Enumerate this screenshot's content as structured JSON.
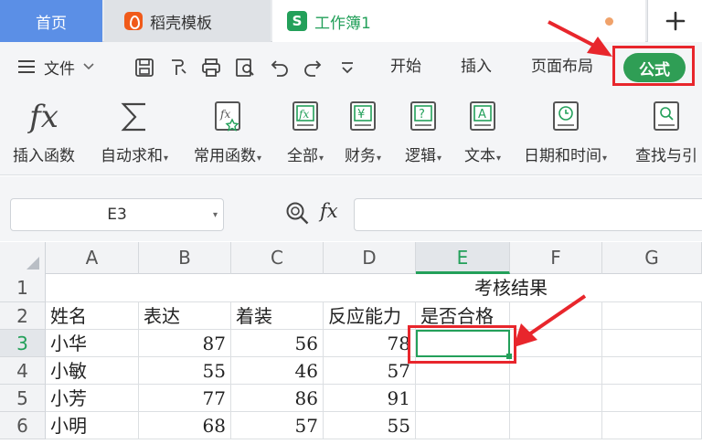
{
  "tabs": {
    "home": "首页",
    "template": "稻壳模板",
    "workbook": "工作簿1",
    "workbook_logo": "S",
    "new_tab": "+"
  },
  "menu": {
    "file": "文件",
    "items": [
      "开始",
      "插入",
      "页面布局"
    ],
    "active": "公式"
  },
  "ribbon": {
    "items": [
      {
        "label": "插入函数",
        "icon": "fx-icon",
        "has_caret": false
      },
      {
        "label": "自动求和",
        "icon": "sigma-icon",
        "has_caret": true
      },
      {
        "label": "常用函数",
        "icon": "fx-star-icon",
        "has_caret": true
      },
      {
        "label": "全部",
        "icon": "fx-book-icon",
        "has_caret": true
      },
      {
        "label": "财务",
        "icon": "yen-book-icon",
        "has_caret": true
      },
      {
        "label": "逻辑",
        "icon": "question-book-icon",
        "has_caret": true
      },
      {
        "label": "文本",
        "icon": "a-book-icon",
        "has_caret": true
      },
      {
        "label": "日期和时间",
        "icon": "clock-book-icon",
        "has_caret": true
      },
      {
        "label": "查找与引",
        "icon": "search-book-icon",
        "has_caret": false
      }
    ]
  },
  "formula_bar": {
    "cell_ref": "E3",
    "fx": "fx",
    "value": ""
  },
  "sheet": {
    "columns": [
      "A",
      "B",
      "C",
      "D",
      "E",
      "F",
      "G"
    ],
    "selected_column": "E",
    "rows": [
      "1",
      "2",
      "3",
      "4",
      "5",
      "6"
    ],
    "selected_row": "3",
    "merged_title": "考核结果",
    "cells": [
      [
        "",
        "",
        "",
        "",
        "",
        "",
        ""
      ],
      [
        "姓名",
        "表达",
        "着装",
        "反应能力",
        "是否合格",
        "",
        ""
      ],
      [
        "小华",
        "87",
        "56",
        "78",
        "",
        "",
        ""
      ],
      [
        "小敏",
        "55",
        "46",
        "57",
        "",
        "",
        ""
      ],
      [
        "小芳",
        "77",
        "86",
        "91",
        "",
        "",
        ""
      ],
      [
        "小明",
        "68",
        "57",
        "55",
        "",
        "",
        ""
      ]
    ]
  },
  "colors": {
    "accent_green": "#23a05a",
    "home_tab_blue": "#5b8fe6",
    "annotation_red": "#e8262c"
  }
}
